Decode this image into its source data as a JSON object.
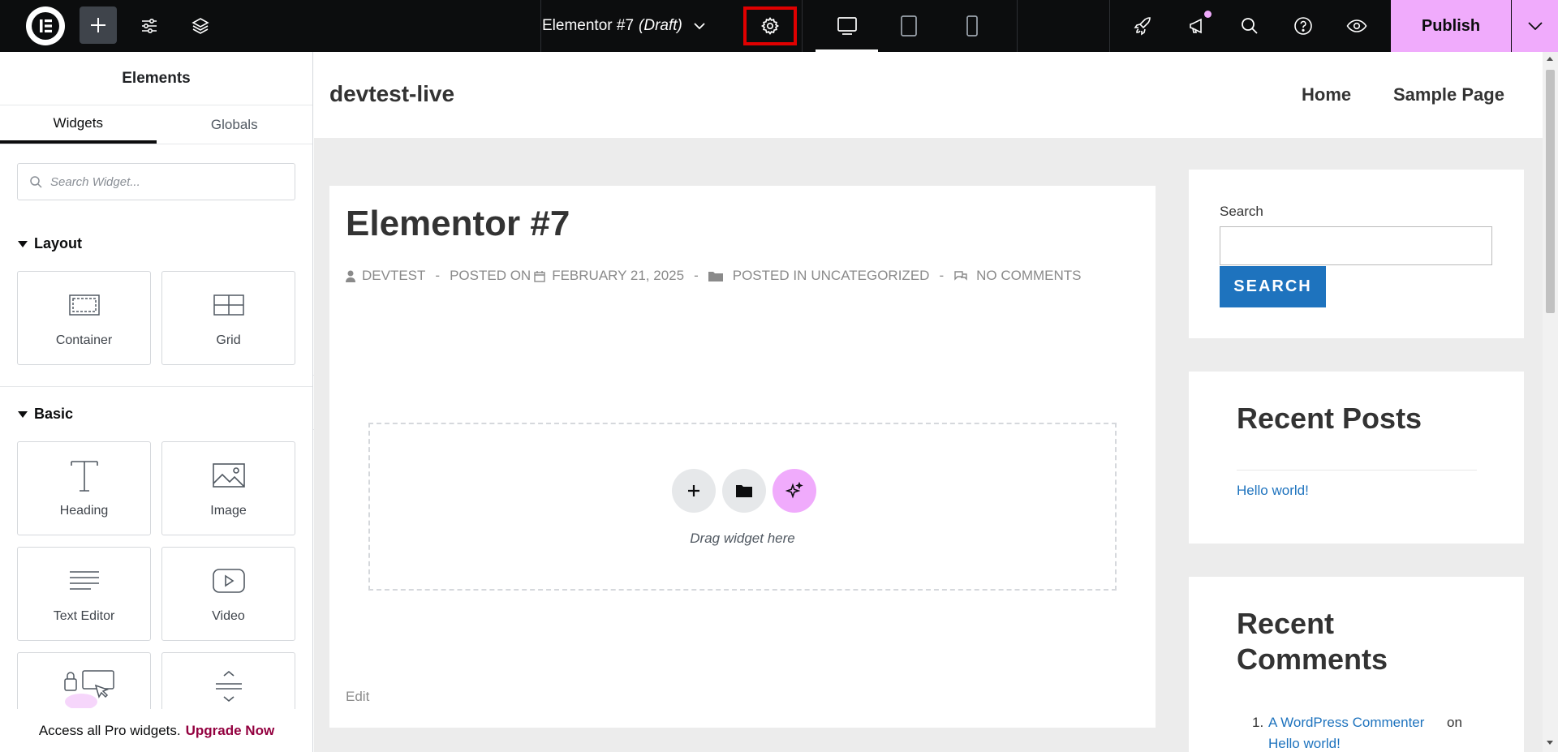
{
  "topbar": {
    "doc_title": "Elementor #7",
    "doc_status": "(Draft)",
    "publish_label": "Publish",
    "icons": [
      "elementor-logo-icon",
      "plus-icon",
      "sliders-icon",
      "layers-icon",
      "chevron-down-icon",
      "gear-icon",
      "desktop-icon",
      "tablet-icon",
      "mobile-icon",
      "rocket-icon",
      "megaphone-icon",
      "search-icon",
      "help-icon",
      "eye-icon",
      "chevron-down-icon"
    ],
    "accent_color": "#f0abfc"
  },
  "annotation": {
    "color": "#e00000"
  },
  "panel": {
    "title": "Elements",
    "tabs": [
      "Widgets",
      "Globals"
    ],
    "search_placeholder": "Search Widget...",
    "categories": {
      "layout": "Layout",
      "basic": "Basic"
    },
    "layout_widgets": [
      "Container",
      "Grid"
    ],
    "basic_widgets": [
      "Heading",
      "Image",
      "Text Editor",
      "Video"
    ],
    "upgrade_text": "Access all Pro widgets.",
    "upgrade_link": "Upgrade Now",
    "upgrade_color": "#93003f"
  },
  "site": {
    "title": "devtest-live",
    "nav": [
      "Home",
      "Sample Page"
    ]
  },
  "post": {
    "title": "Elementor #7",
    "author": "DEVTEST",
    "posted_on_label": "POSTED ON",
    "date": "FEBRUARY 21, 2025",
    "posted_in_label": "POSTED IN",
    "category": "UNCATEGORIZED",
    "comments": "NO COMMENTS",
    "separator": "-",
    "dropzone_text": "Drag widget here",
    "edit_label": "Edit"
  },
  "sidebar": {
    "search_label": "Search",
    "search_button": "SEARCH",
    "recent_posts_title": "Recent Posts",
    "recent_posts": [
      "Hello world!"
    ],
    "recent_comments_title": "Recent Comments",
    "recent_comment": {
      "index": "1.",
      "author": "A WordPress Commenter",
      "on": "on",
      "post": "Hello world!"
    },
    "link_color": "#1e73be"
  }
}
